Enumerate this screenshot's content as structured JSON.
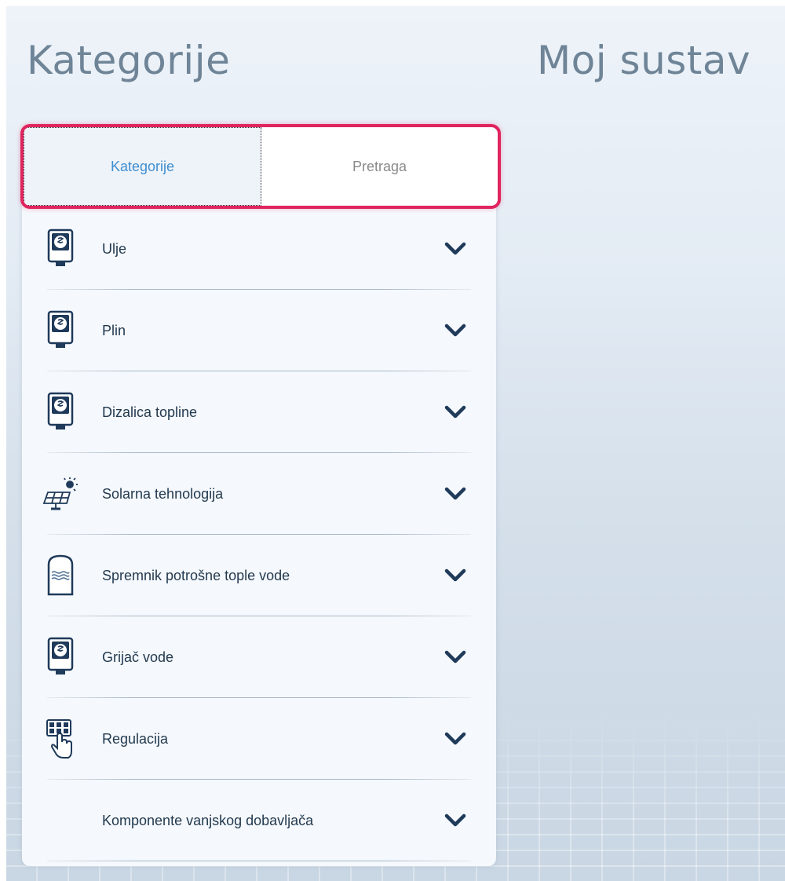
{
  "headings": {
    "left": "Kategorije",
    "right": "Moj sustav"
  },
  "tabs": [
    {
      "label": "Kategorije",
      "active": true
    },
    {
      "label": "Pretraga",
      "active": false
    }
  ],
  "categories": [
    {
      "label": "Ulje",
      "icon": "boiler-icon"
    },
    {
      "label": "Plin",
      "icon": "boiler-icon"
    },
    {
      "label": "Dizalica topline",
      "icon": "boiler-icon"
    },
    {
      "label": "Solarna tehnologija",
      "icon": "solar-panel-icon"
    },
    {
      "label": "Spremnik potrošne tople vode",
      "icon": "water-tank-icon"
    },
    {
      "label": "Grijač vode",
      "icon": "boiler-icon"
    },
    {
      "label": "Regulacija",
      "icon": "control-keypad-icon"
    },
    {
      "label": "Komponente vanjskog dobavljača",
      "icon": ""
    }
  ],
  "colors": {
    "accent": "#3e8ed0",
    "highlight": "#e0245e",
    "text": "#233a4f",
    "icon": "#1f3a5a"
  }
}
